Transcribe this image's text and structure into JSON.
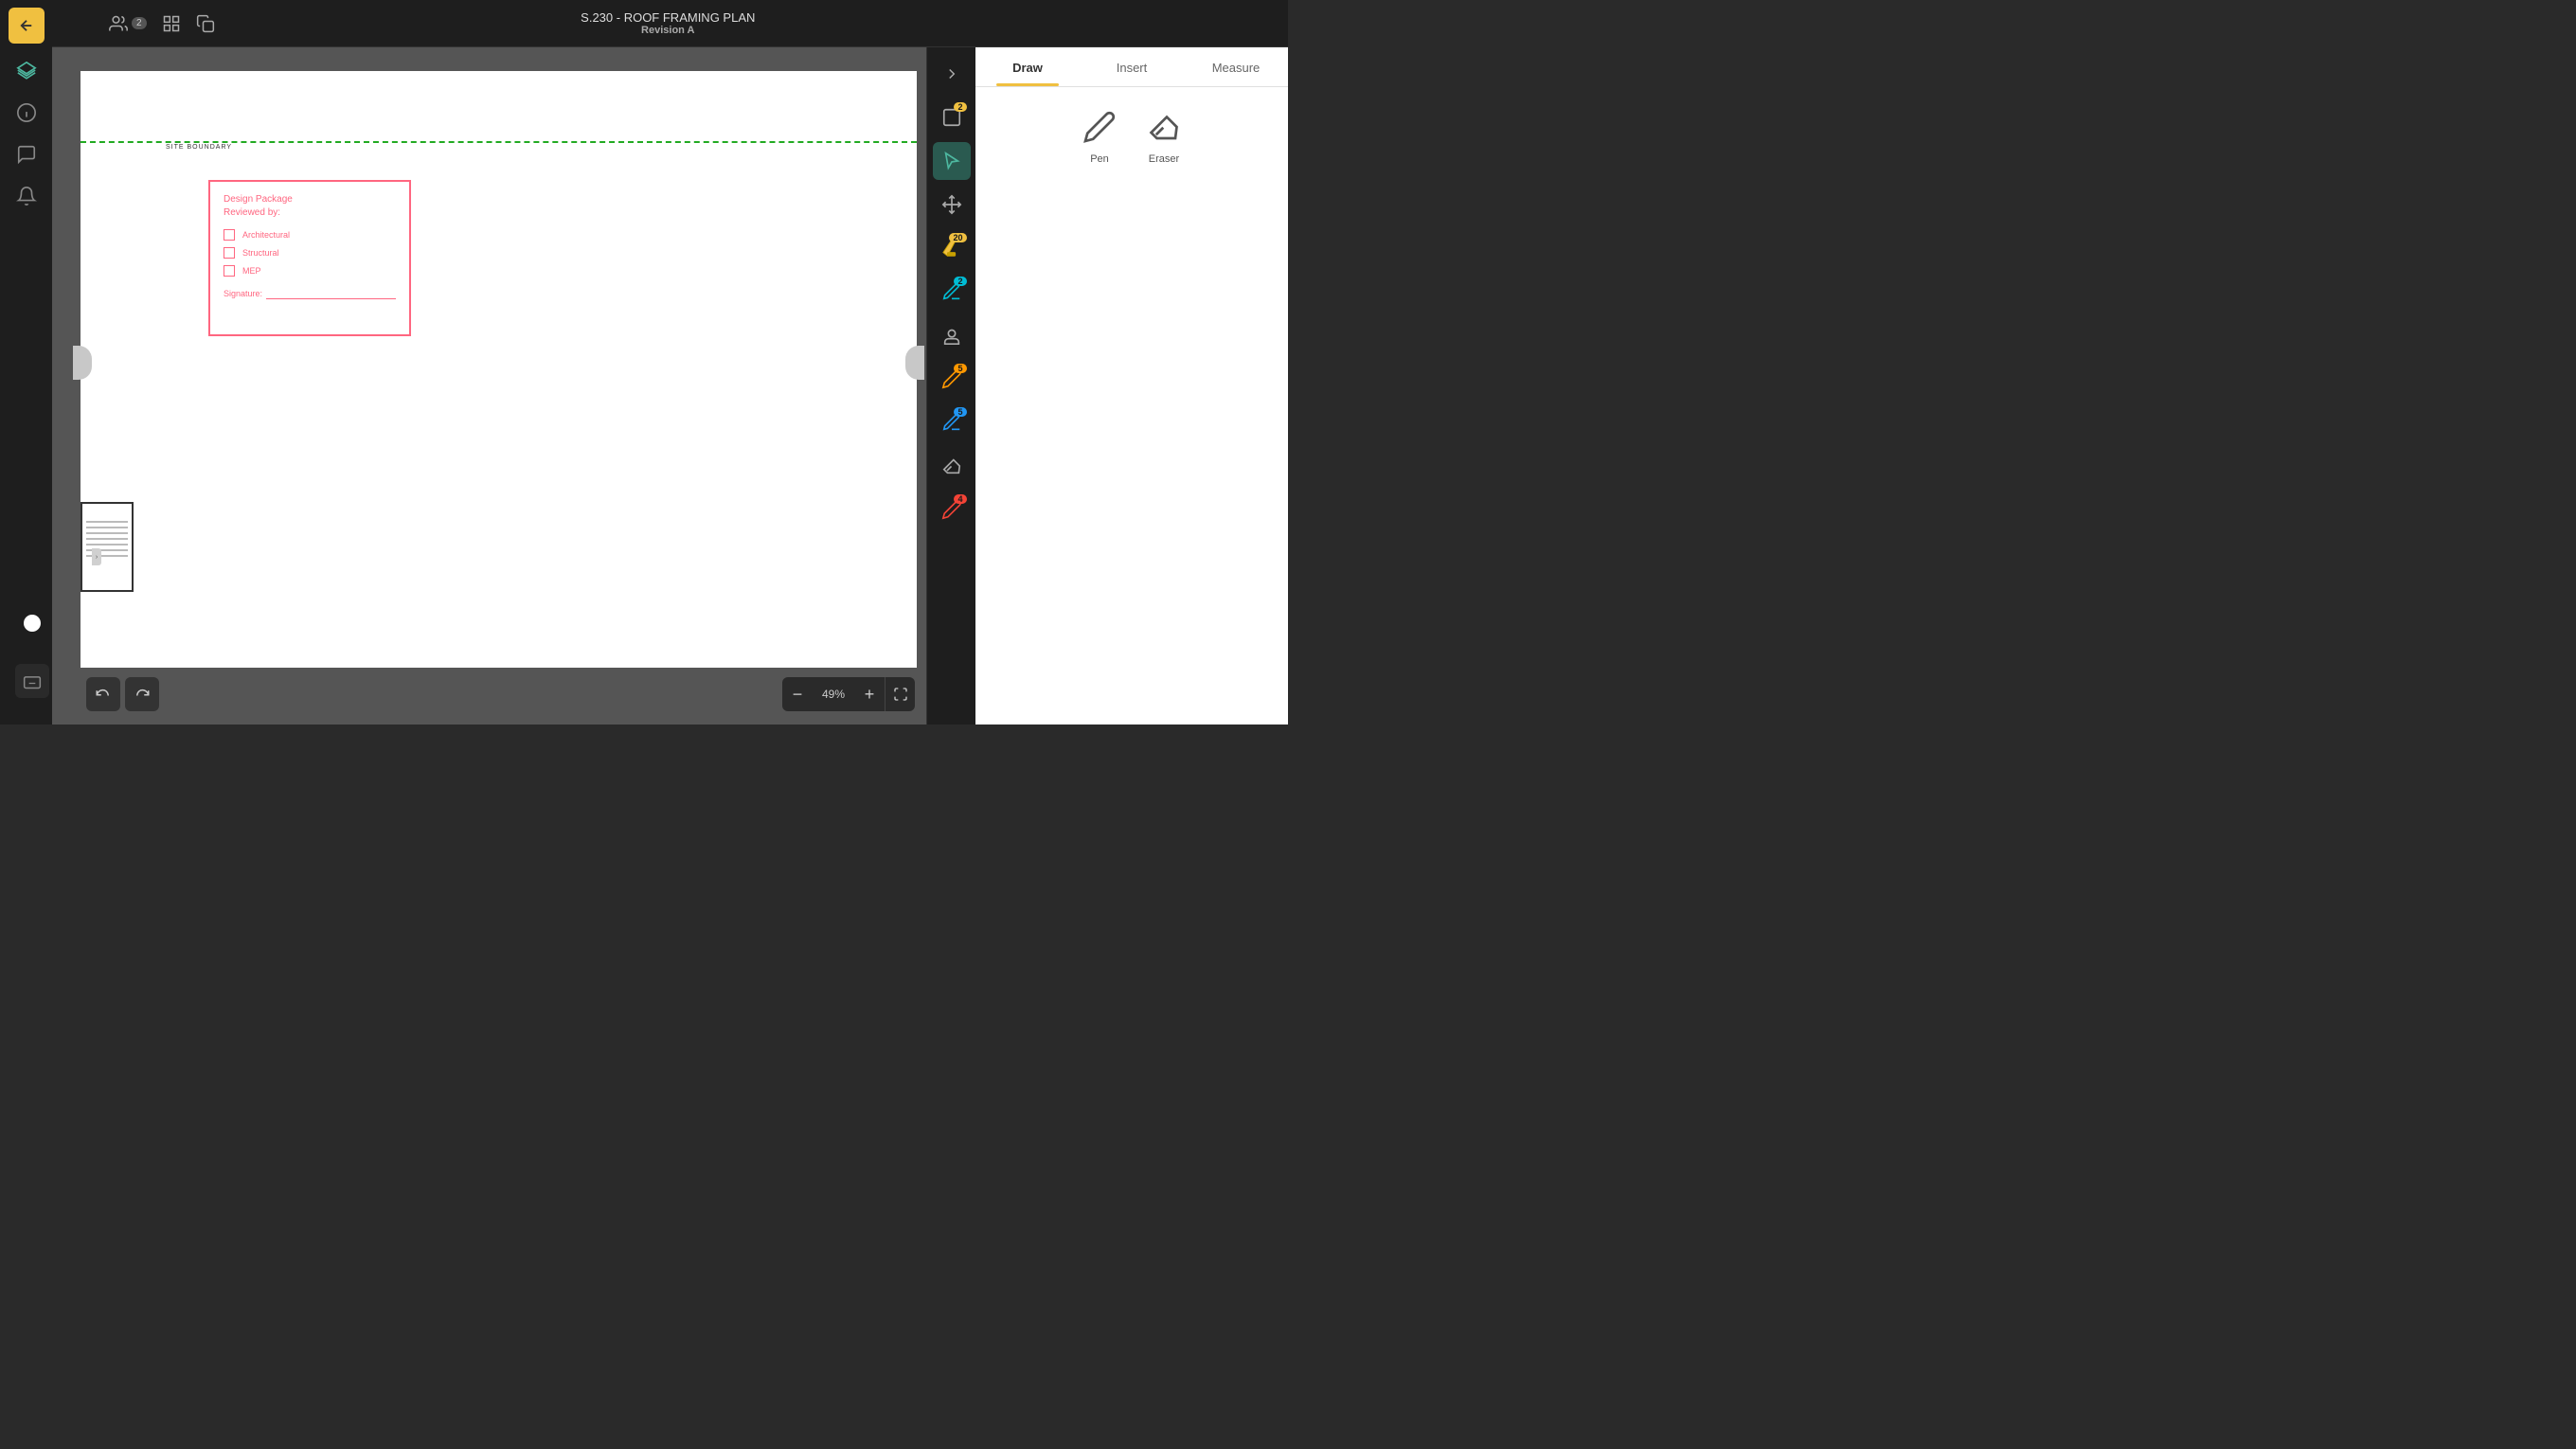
{
  "app": {
    "title": "S.230 - ROOF FRAMING PLAN",
    "subtitle": "Revision A"
  },
  "topbar": {
    "back_label": "←",
    "logo_alt": "layers-icon",
    "icons": [
      {
        "name": "review-icon",
        "badge": "2"
      },
      {
        "name": "grid-icon"
      },
      {
        "name": "copy-icon"
      }
    ]
  },
  "tabs": [
    {
      "id": "draw",
      "label": "Draw",
      "active": true
    },
    {
      "id": "insert",
      "label": "Insert",
      "active": false
    },
    {
      "id": "measure",
      "label": "Measure",
      "active": false
    }
  ],
  "tools": {
    "pen_label": "Pen",
    "eraser_label": "Eraser"
  },
  "canvas": {
    "site_boundary_label": "SITE BOUNDARY",
    "zoom_percent": "49%",
    "zoom_minus": "−",
    "zoom_plus": "+",
    "undo_label": "↩",
    "redo_label": "↪"
  },
  "design_package": {
    "title_line1": "Design Package",
    "title_line2": "Reviewed by:",
    "items": [
      "Architectural",
      "Structural",
      "MEP"
    ],
    "signature_label": "Signature:"
  },
  "right_toolbar": [
    {
      "name": "select-tool",
      "badge": "2",
      "badge_color": "yellow"
    },
    {
      "name": "cursor-tool",
      "active": true
    },
    {
      "name": "move-tool"
    },
    {
      "name": "annotation-tool",
      "badge": "20",
      "badge_color": "yellow"
    },
    {
      "name": "pen-annotation-tool",
      "badge": "2",
      "badge_color": "cyan"
    },
    {
      "name": "stamp-tool"
    },
    {
      "name": "pencil-tool",
      "badge": "5",
      "badge_color": "orange"
    },
    {
      "name": "marker-tool",
      "badge": "5",
      "badge_color": "blue"
    },
    {
      "name": "eraser-tool"
    },
    {
      "name": "redline-tool",
      "badge": "4",
      "badge_color": "red"
    }
  ]
}
